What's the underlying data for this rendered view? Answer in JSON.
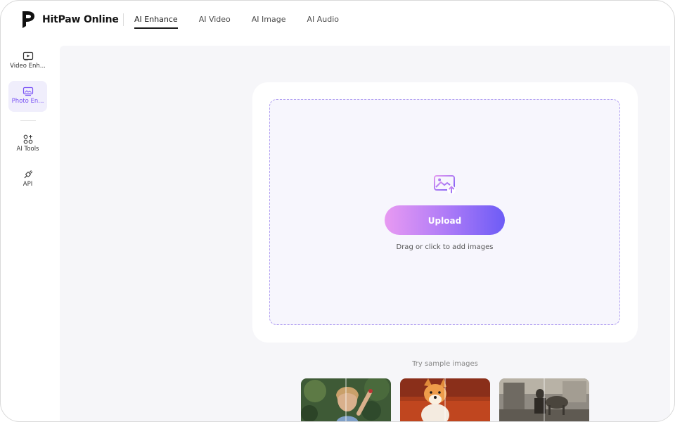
{
  "header": {
    "brand": "HitPaw Online",
    "nav": [
      "AI Enhance",
      "AI Video",
      "AI Image",
      "AI Audio"
    ],
    "active_nav": "AI Enhance"
  },
  "sidebar": {
    "items": [
      {
        "label": "Video Enh...",
        "icon": "video-enhance-icon"
      },
      {
        "label": "Photo En...",
        "icon": "photo-enhance-icon",
        "active": true
      },
      {
        "label": "AI Tools",
        "icon": "ai-tools-icon"
      },
      {
        "label": "API",
        "icon": "api-plug-icon"
      }
    ]
  },
  "upload": {
    "icon": "image-upload-icon",
    "button_label": "Upload",
    "hint": "Drag or click to add images"
  },
  "samples": {
    "title": "Try sample images",
    "items": [
      {
        "name": "sample-girl-photo"
      },
      {
        "name": "sample-dog-photo"
      },
      {
        "name": "sample-vintage-photo"
      }
    ]
  },
  "colors": {
    "accent": "#7a54f5",
    "gradient_start": "#e89af2",
    "gradient_end": "#6d5cf6",
    "dropzone_border": "#b3a1f2",
    "main_bg": "#f6f6f9"
  }
}
